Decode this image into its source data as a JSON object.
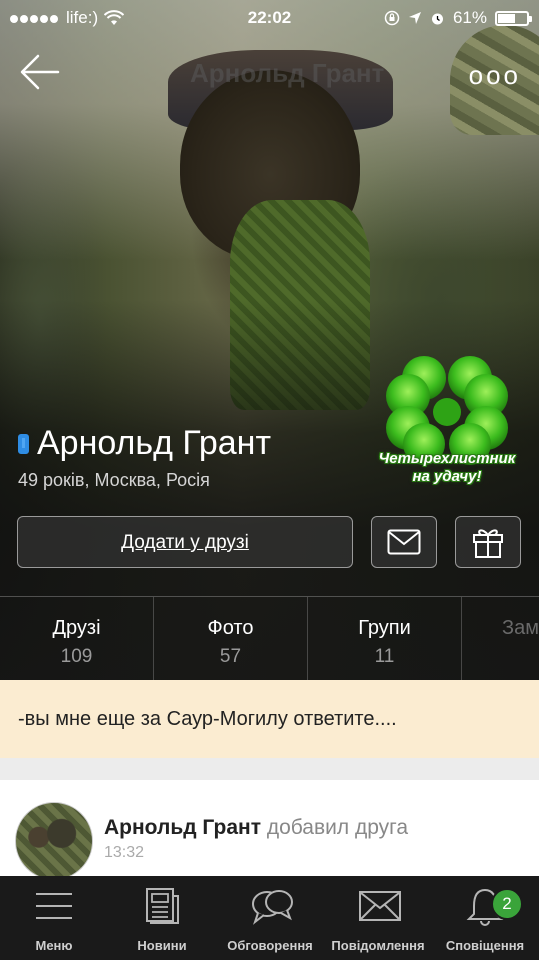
{
  "status_bar": {
    "carrier": "life:)",
    "time": "22:02",
    "battery": "61%",
    "battery_level": 0.61
  },
  "header": {
    "faded_title": "Арнольд Грант",
    "back_icon": "arrow-left-icon",
    "more_icon": "more-dots-icon",
    "more_label": "ooo"
  },
  "profile": {
    "name": "Арнольд Грант",
    "meta": "49 років, Москва, Росія",
    "device_icon": "mobile-phone-icon",
    "sticker_caption": "Четырехлистник на удачу!",
    "add_friend_label": "Додати у друзі",
    "message_icon": "envelope-icon",
    "gift_icon": "gift-icon"
  },
  "stats": [
    {
      "label": "Друзі",
      "value": "109"
    },
    {
      "label": "Фото",
      "value": "57"
    },
    {
      "label": "Групи",
      "value": "11"
    },
    {
      "label": "Зам",
      "value": ""
    }
  ],
  "status_message": "-вы мне еще за Саур-Могилу ответите....",
  "feed": {
    "author": "Арнольд Грант",
    "action": "добавил друга",
    "time": "13:32"
  },
  "tabbar": [
    {
      "label": "Меню",
      "icon": "hamburger-menu-icon"
    },
    {
      "label": "Новини",
      "icon": "newspaper-icon"
    },
    {
      "label": "Обговорення",
      "icon": "chat-bubbles-icon"
    },
    {
      "label": "Повідомлення",
      "icon": "envelope-icon"
    },
    {
      "label": "Сповіщення",
      "icon": "bell-icon",
      "badge": "2"
    }
  ],
  "colors": {
    "accent_blue": "#2f8de4",
    "status_message_bg": "#fbecd1",
    "tabbar_bg": "#1a1a1a",
    "badge_green": "#3aa43a",
    "clover_green": "#3cbc1e"
  }
}
